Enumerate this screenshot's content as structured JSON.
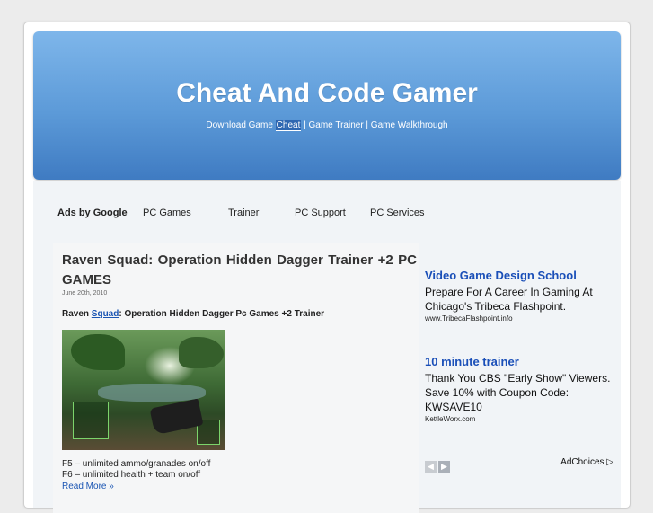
{
  "header": {
    "title": "Cheat And Code Gamer",
    "tagline_prefix": "Download Game ",
    "tagline_keyword": "Cheat",
    "tagline_suffix": " | Game Trainer | Game Walkthrough"
  },
  "adnav": {
    "ads_by": "Ads by Google",
    "links": [
      "PC Games",
      "Trainer",
      "PC Support",
      "PC Services"
    ]
  },
  "post": {
    "title": "Raven Squad: Operation Hidden Dagger Trainer +2 PC GAMES",
    "date": "June 20th, 2010",
    "subtitle_prefix": "Raven ",
    "subtitle_keyword": "Squad",
    "subtitle_suffix": ": Operation Hidden Dagger Pc Games +2 Trainer",
    "lines": [
      "F5 – unlimited ammo/granades on/off",
      "F6 – unlimited health + team on/off"
    ],
    "read_more": "Read More »"
  },
  "sidebar": {
    "ads": [
      {
        "title": "Video Game Design School",
        "text": "Prepare For A Career In Gaming At Chicago's Tribeca Flashpoint.",
        "url": "www.TribecaFlashpoint.info"
      },
      {
        "title": "10 minute trainer",
        "text": "Thank You CBS \"Early Show\" Viewers. Save 10% with Coupon Code: KWSAVE10",
        "url": "KettleWorx.com"
      }
    ],
    "prev_arrow": "◀",
    "next_arrow": "▶",
    "adchoices": "AdChoices ▷"
  }
}
